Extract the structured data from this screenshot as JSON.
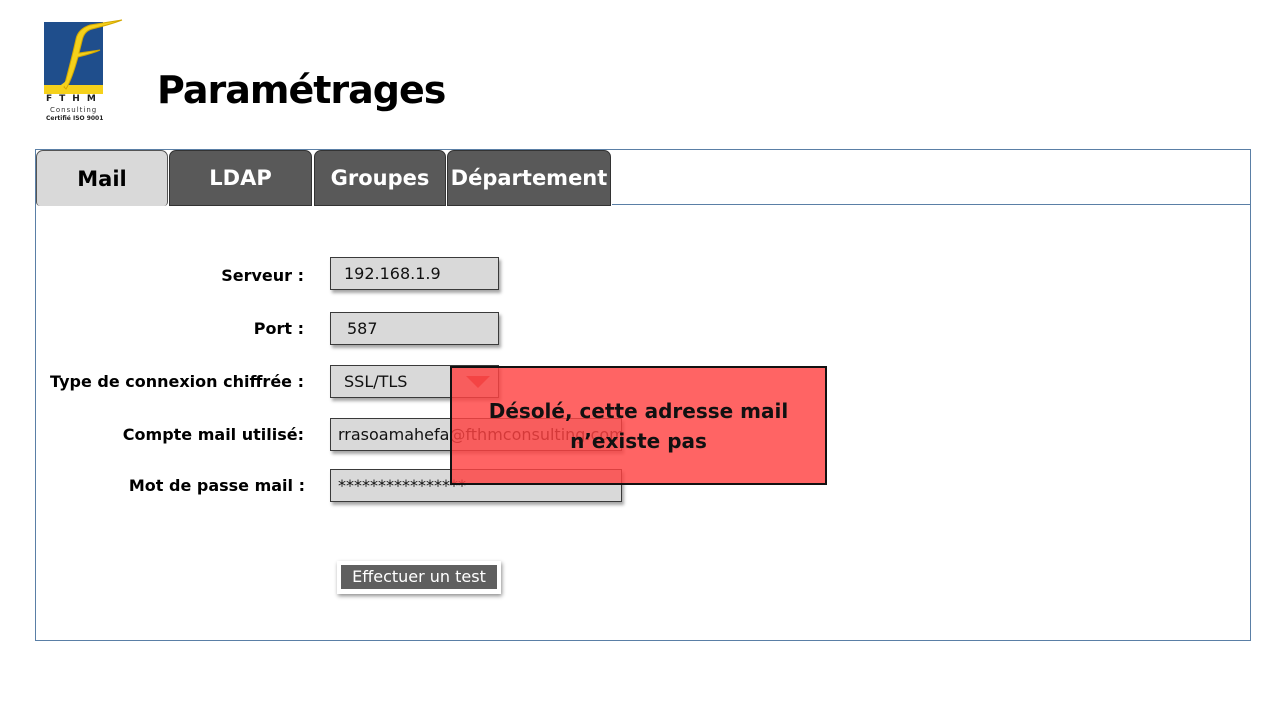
{
  "logo": {
    "letters": "FTHM",
    "subtitle": "Consulting",
    "certification": "Certifié ISO 9001",
    "colors": {
      "blue": "#1f4e8c",
      "yellow": "#f5d11b"
    }
  },
  "page_title": "Paramétrages",
  "tabs": [
    {
      "label": "Mail",
      "active": true
    },
    {
      "label": "LDAP",
      "active": false
    },
    {
      "label": "Groupes",
      "active": false
    },
    {
      "label": "Département",
      "active": false
    }
  ],
  "form": {
    "server": {
      "label": "Serveur :",
      "value": "192.168.1.9"
    },
    "port": {
      "label": "Port :",
      "value": "587"
    },
    "encryption": {
      "label": "Type de connexion chiffrée :",
      "value": "SSL/TLS",
      "icon": "dropdown-arrow-icon"
    },
    "account": {
      "label": "Compte mail utilisé:",
      "value": "rrasoamahefa@fthmconsulting.com"
    },
    "password": {
      "label": "Mot de passe mail :",
      "value": "****************"
    }
  },
  "test_button": {
    "label": "Effectuer un test"
  },
  "alert": {
    "message": "Désolé, cette adresse mail n’existe pas",
    "color": "#ff4242"
  }
}
